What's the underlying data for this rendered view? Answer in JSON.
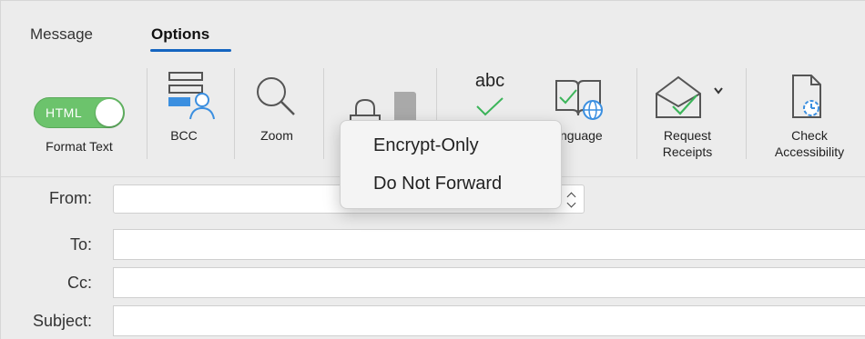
{
  "tabs": {
    "message": "Message",
    "options": "Options"
  },
  "ribbon": {
    "format_toggle": "HTML",
    "format_label": "Format Text",
    "bcc_label": "BCC",
    "zoom_label": "Zoom",
    "abc_text": "abc",
    "language_label": "nguage",
    "receipts_label_1": "Request",
    "receipts_label_2": "Receipts",
    "accessibility_label_1": "Check",
    "accessibility_label_2": "Accessibility"
  },
  "encrypt_menu": {
    "items": [
      "Encrypt-Only",
      "Do Not Forward"
    ]
  },
  "form": {
    "from_label": "From:",
    "to_label": "To:",
    "cc_label": "Cc:",
    "subject_label": "Subject:"
  },
  "colors": {
    "accent": "#1565c0",
    "toggle_on": "#6cc36c",
    "check_green": "#3cb55a",
    "bcc_blue": "#3b8fe0"
  }
}
